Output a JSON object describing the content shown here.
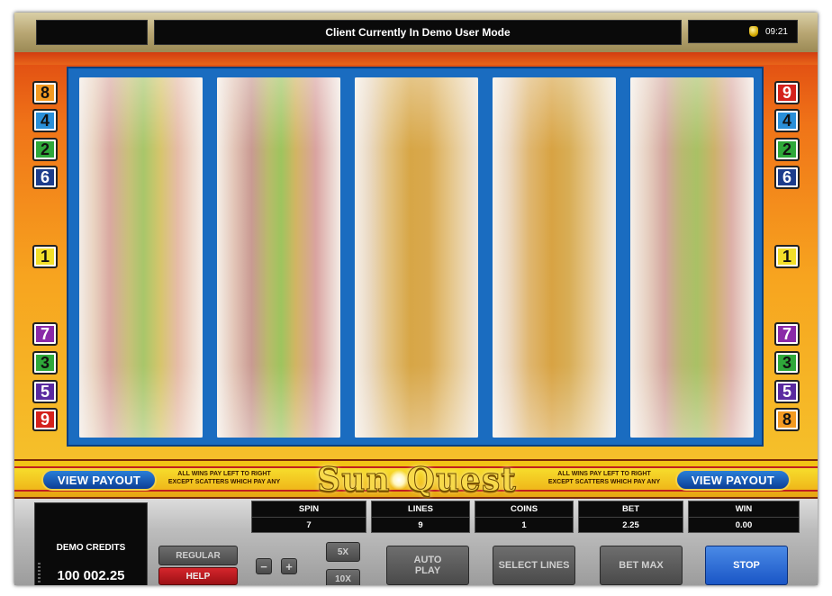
{
  "topbar": {
    "left_text": "",
    "status_message": "Client Currently In Demo User Mode",
    "clock": "09:21",
    "clock_icon": "coin-stack-icon"
  },
  "paylines": {
    "left": [
      {
        "num": "8",
        "color": "#f39a22"
      },
      {
        "num": "4",
        "color": "#2a8fd8"
      },
      {
        "num": "2",
        "color": "#2fa83a"
      },
      {
        "num": "6",
        "color": "#1d3d8c"
      },
      {
        "num": "1",
        "color": "#f3df2a"
      },
      {
        "num": "7",
        "color": "#8a2aa8"
      },
      {
        "num": "3",
        "color": "#2fa83a"
      },
      {
        "num": "5",
        "color": "#5a2aa0"
      },
      {
        "num": "9",
        "color": "#d4221c"
      }
    ],
    "right": [
      {
        "num": "9",
        "color": "#d4221c"
      },
      {
        "num": "4",
        "color": "#2a8fd8"
      },
      {
        "num": "2",
        "color": "#2fa83a"
      },
      {
        "num": "6",
        "color": "#1d3d8c"
      },
      {
        "num": "1",
        "color": "#f3df2a"
      },
      {
        "num": "7",
        "color": "#8a2aa8"
      },
      {
        "num": "3",
        "color": "#2fa83a"
      },
      {
        "num": "5",
        "color": "#5a2aa0"
      },
      {
        "num": "8",
        "color": "#f39a22"
      }
    ]
  },
  "logo_bar": {
    "view_payout_left": "VIEW PAYOUT",
    "view_payout_right": "VIEW PAYOUT",
    "rule_line1": "ALL WINS PAY LEFT TO RIGHT",
    "rule_line2": "EXCEPT SCATTERS WHICH PAY ANY",
    "logo_part1": "Sun",
    "logo_part2": "Quest"
  },
  "panel": {
    "credits_label": "DEMO CREDITS",
    "credits_value": "100 002.25",
    "spin_label": "SPIN",
    "spin_value": "7",
    "lines_label": "LINES",
    "lines_value": "9",
    "coins_label": "COINS",
    "coins_value": "1",
    "bet_label": "BET",
    "bet_value": "2.25",
    "win_label": "WIN",
    "win_value": "0.00",
    "regular_label": "REGULAR",
    "help_label": "HELP",
    "minus_label": "−",
    "plus_label": "+",
    "x5_label": "5X",
    "x10_label": "10X",
    "auto_play_line1": "AUTO",
    "auto_play_line2": "PLAY",
    "select_lines_label": "SELECT LINES",
    "bet_max_label": "BET MAX",
    "stop_label": "STOP"
  },
  "colors": {
    "accent_blue": "#1a6cc0",
    "stop_blue": "#1a56c6",
    "help_red": "#d4221c",
    "logo_gold": "#f7d94a"
  }
}
